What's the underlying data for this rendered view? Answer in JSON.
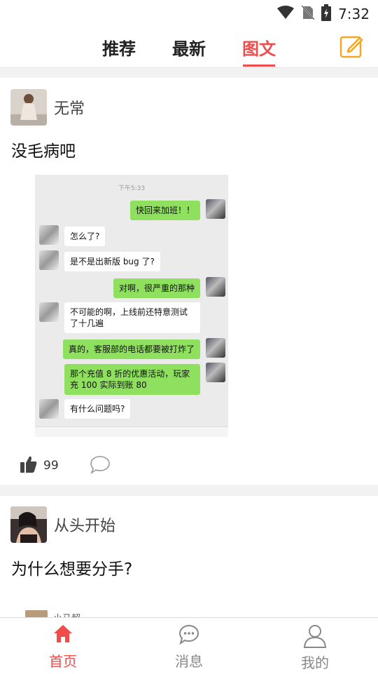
{
  "status_bar": {
    "time": "7:32"
  },
  "top_tabs": [
    {
      "label": "推荐",
      "active": false
    },
    {
      "label": "最新",
      "active": false
    },
    {
      "label": "图文",
      "active": true
    }
  ],
  "accent_color": "#f04c4c",
  "posts": [
    {
      "username": "无常",
      "text": "没毛病吧",
      "likes": "99",
      "screenshot": {
        "time": "下午5:33",
        "messages": [
          {
            "side": "right",
            "text": "快回来加班！！"
          },
          {
            "side": "left",
            "text": "怎么了?"
          },
          {
            "side": "left",
            "text": "是不是出新版 bug 了?"
          },
          {
            "side": "right",
            "text": "对啊，很严重的那种"
          },
          {
            "side": "left",
            "text": "不可能的啊，上线前还特意测试了十几遍"
          },
          {
            "side": "right",
            "text": "真的，客服部的电话都要被打炸了"
          },
          {
            "side": "right",
            "text": "那个充值 8 折的优惠活动，玩家充 100 实际到账 80"
          },
          {
            "side": "left",
            "text": "有什么问题吗?"
          }
        ]
      }
    },
    {
      "username": "从头开始",
      "text": "为什么想要分手?",
      "peek_username": "小马超"
    }
  ],
  "bottom_nav": [
    {
      "label": "首页",
      "icon": "home-icon",
      "active": true
    },
    {
      "label": "消息",
      "icon": "message-icon",
      "active": false
    },
    {
      "label": "我的",
      "icon": "user-icon",
      "active": false
    }
  ]
}
